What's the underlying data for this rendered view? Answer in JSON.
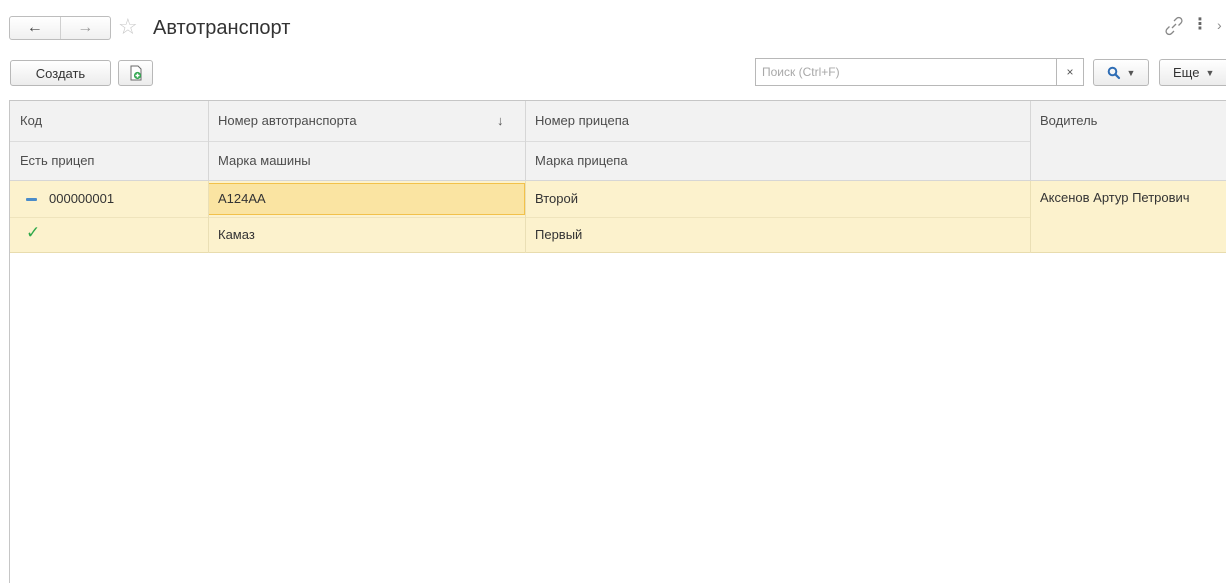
{
  "window": {
    "title": "Автотранспорт",
    "icons": {
      "back": "arrow-left-icon",
      "forward": "arrow-right-icon",
      "favorite": "star-icon",
      "link": "link-icon",
      "more": "more-vert-icon",
      "close": "close-icon"
    }
  },
  "toolbar": {
    "create_label": "Создать",
    "copy_icon": "document-add-icon",
    "search_placeholder": "Поиск (Ctrl+F)",
    "search_value": "",
    "clear_label": "×",
    "more_label": "Еще"
  },
  "table": {
    "columns_row1": [
      "Код",
      "Номер автотранспорта",
      "Номер прицепа",
      "Водитель"
    ],
    "columns_row2": [
      "Есть прицеп",
      "Марка машины",
      "Марка прицепа"
    ],
    "sort_indicator": "↓",
    "rows": [
      {
        "code": "000000001",
        "has_trailer": true,
        "vehicle_number": "А124АА",
        "car_brand": "Камаз",
        "trailer_number": "Второй",
        "trailer_brand": "Первый",
        "driver": "Аксенов Артур Петрович"
      }
    ]
  },
  "colors": {
    "selected_row": "#fcf2cd",
    "focused_cell": "#fae4a2",
    "focus_border": "#f2c14a",
    "header_bg": "#f2f2f2",
    "check": "#2ea84a",
    "group_marker": "#4b8cc9"
  }
}
